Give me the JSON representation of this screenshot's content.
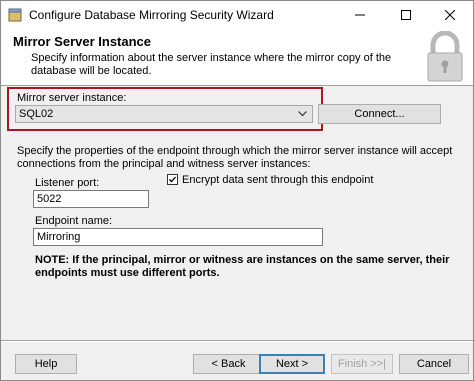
{
  "window": {
    "title": "Configure Database Mirroring Security Wizard"
  },
  "banner": {
    "title": "Mirror Server Instance",
    "description": "Specify information about the server instance where the mirror copy of the database will be located."
  },
  "mirror": {
    "label": "Mirror server instance:",
    "selected": "SQL02",
    "connect_label": "Connect..."
  },
  "endpoint": {
    "description": "Specify the properties of the endpoint through which the mirror server instance will accept connections from the principal and witness server instances:",
    "listener_port_label": "Listener port:",
    "listener_port_value": "5022",
    "encrypt_label": "Encrypt data sent through this endpoint",
    "encrypt_checked": true,
    "endpoint_name_label": "Endpoint name:",
    "endpoint_name_value": "Mirroring",
    "note": "NOTE: If the principal, mirror or witness are instances on the same server, their endpoints must use different ports."
  },
  "footer": {
    "help": "Help",
    "back": "< Back",
    "next": "Next >",
    "finish": "Finish >>|",
    "cancel": "Cancel"
  },
  "colors": {
    "highlight_border": "#b0141e",
    "default_button_border": "#3c7fb1"
  }
}
